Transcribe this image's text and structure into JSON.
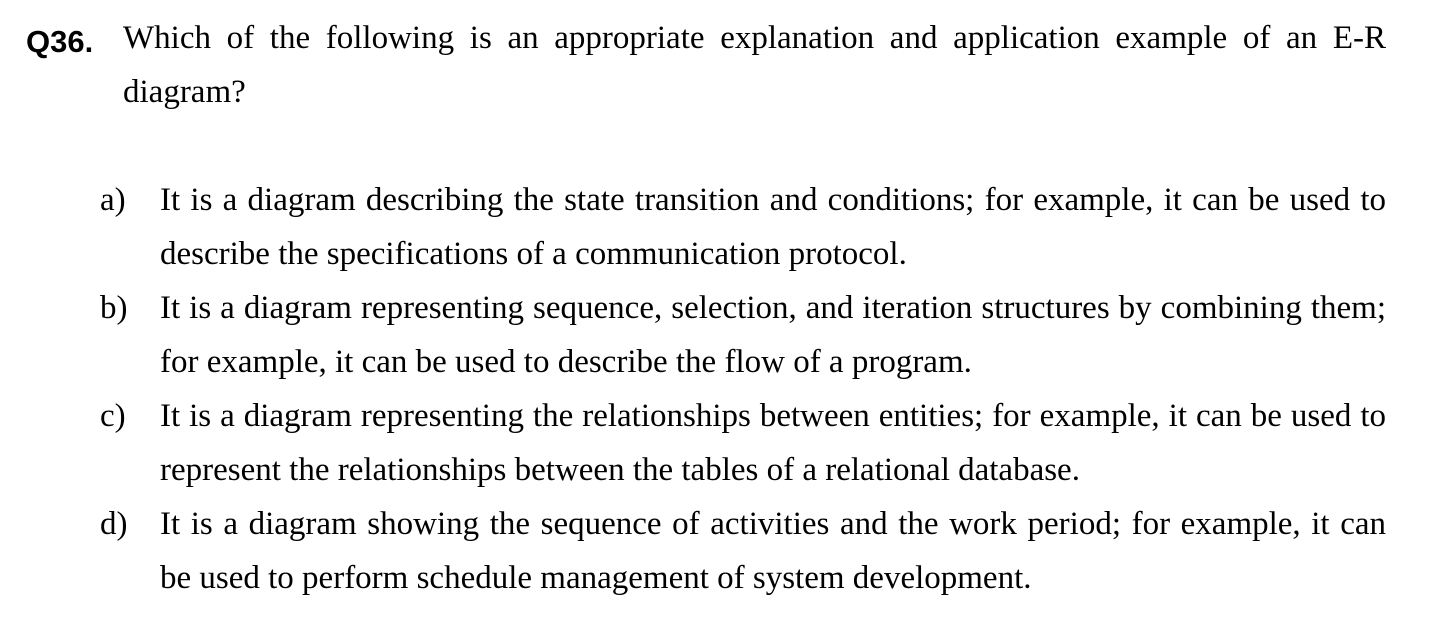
{
  "question": {
    "number": "Q36.",
    "text": "Which of the following is an appropriate explanation and application example of an E-R diagram?"
  },
  "options": [
    {
      "label": "a)",
      "text": "It is a diagram describing the state transition and conditions; for example, it can be used to describe the specifications of a communication protocol."
    },
    {
      "label": "b)",
      "text": "It is a diagram representing sequence, selection, and iteration structures by combining them; for example, it can be used to describe the flow of a program."
    },
    {
      "label": "c)",
      "text": "It is a diagram representing the relationships between entities; for example, it can be used to represent the relationships between the tables of a relational database."
    },
    {
      "label": "d)",
      "text": "It is a diagram showing the sequence of activities and the work period; for example, it can be used to perform schedule management of system development."
    }
  ]
}
